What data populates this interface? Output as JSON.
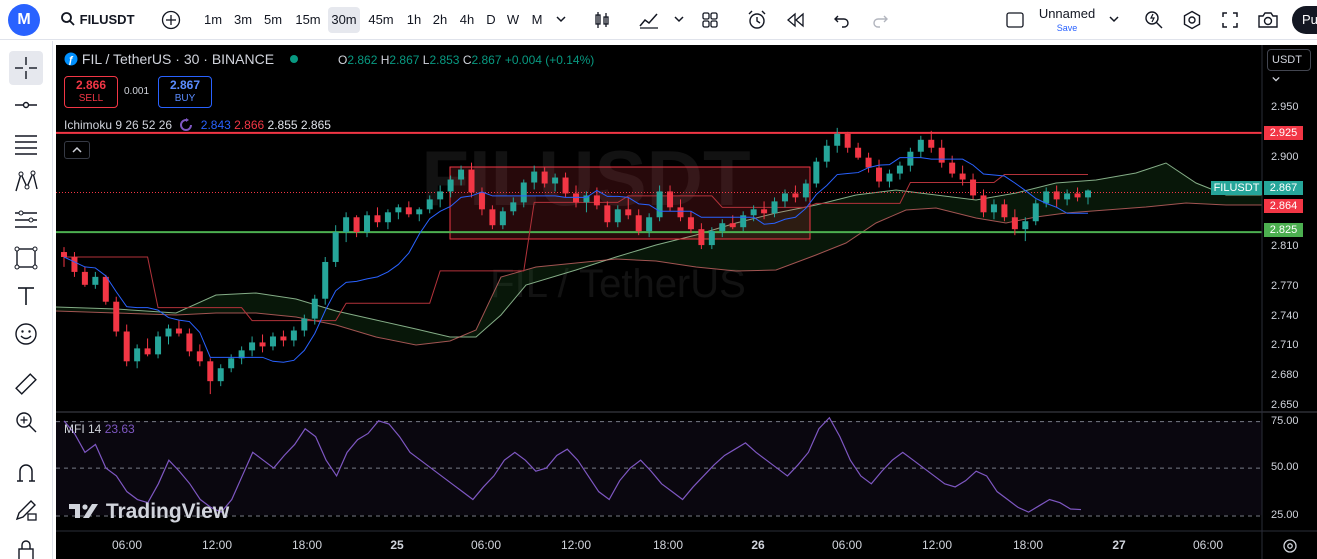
{
  "header": {
    "logo": "M",
    "symbol": "FILUSDT",
    "intervals": [
      "1m",
      "3m",
      "5m",
      "15m",
      "30m",
      "45m",
      "1h",
      "2h",
      "4h",
      "D",
      "W",
      "M"
    ],
    "selected_interval": "30m",
    "layout_name": "Unnamed",
    "save_label": "Save",
    "publish_label": "Pu"
  },
  "legend": {
    "title": "FIL / TetherUS · 30 · BINANCE",
    "o_label": "O",
    "o": "2.862",
    "h_label": "H",
    "h": "2.867",
    "l_label": "L",
    "l": "2.853",
    "c_label": "C",
    "c": "2.867",
    "change": "+0.004 (+0.14%)",
    "sell_price": "2.866",
    "sell_label": "SELL",
    "spread": "0.001",
    "buy_price": "2.867",
    "buy_label": "BUY",
    "ichimoku_label": "Ichimoku 9 26 52 26",
    "ichimoku_values": [
      "2.843",
      "2.866",
      "2.855",
      "2.865"
    ],
    "ichimoku_colors": [
      "#2962ff",
      "#f23645",
      "#e0e3eb",
      "#e0e3eb"
    ],
    "mfi_label": "MFI 14",
    "mfi_value": "23.63",
    "currency": "USDT"
  },
  "watermark": {
    "big": "FILUSDT",
    "small": "FIL / TetherUS"
  },
  "price_axis": [
    "2.950",
    "2.900",
    "2.810",
    "2.770",
    "2.740",
    "2.710",
    "2.680",
    "2.650"
  ],
  "price_tags": {
    "resistance": "2.925",
    "symbol": "FILUSDT",
    "last": "2.867",
    "red": "2.864",
    "support": "2.825"
  },
  "mfi_axis": [
    "75.00",
    "50.00",
    "25.00"
  ],
  "time_axis": [
    "06:00",
    "12:00",
    "18:00",
    "25",
    "06:00",
    "12:00",
    "18:00",
    "26",
    "06:00",
    "12:00",
    "18:00",
    "27",
    "06:00"
  ],
  "brand": "TradingView",
  "colors": {
    "up": "#26a69a",
    "down": "#f23645",
    "tenkan": "#2962ff",
    "kijun": "#b2323a",
    "resistance": "#f23645",
    "support": "#4caf50",
    "mfi": "#7e57c2"
  },
  "chart_data": {
    "type": "candlestick",
    "interval": "30m",
    "ylim": [
      2.65,
      2.955
    ],
    "ohlc": [
      [
        2.805,
        2.81,
        2.79,
        2.8
      ],
      [
        2.8,
        2.805,
        2.78,
        2.785
      ],
      [
        2.785,
        2.79,
        2.77,
        2.772
      ],
      [
        2.772,
        2.785,
        2.768,
        2.78
      ],
      [
        2.78,
        2.782,
        2.752,
        2.755
      ],
      [
        2.755,
        2.76,
        2.72,
        2.725
      ],
      [
        2.725,
        2.732,
        2.69,
        2.695
      ],
      [
        2.695,
        2.712,
        2.688,
        2.708
      ],
      [
        2.708,
        2.718,
        2.7,
        2.702
      ],
      [
        2.702,
        2.725,
        2.698,
        2.72
      ],
      [
        2.72,
        2.732,
        2.712,
        2.728
      ],
      [
        2.728,
        2.736,
        2.72,
        2.723
      ],
      [
        2.723,
        2.728,
        2.7,
        2.705
      ],
      [
        2.705,
        2.712,
        2.69,
        2.695
      ],
      [
        2.695,
        2.698,
        2.662,
        2.675
      ],
      [
        2.675,
        2.692,
        2.67,
        2.688
      ],
      [
        2.688,
        2.702,
        2.684,
        2.698
      ],
      [
        2.698,
        2.71,
        2.692,
        2.706
      ],
      [
        2.706,
        2.72,
        2.7,
        2.714
      ],
      [
        2.714,
        2.722,
        2.704,
        2.71
      ],
      [
        2.71,
        2.724,
        2.706,
        2.72
      ],
      [
        2.72,
        2.726,
        2.71,
        2.716
      ],
      [
        2.716,
        2.73,
        2.71,
        2.726
      ],
      [
        2.726,
        2.742,
        2.72,
        2.738
      ],
      [
        2.738,
        2.762,
        2.732,
        2.758
      ],
      [
        2.758,
        2.8,
        2.752,
        2.795
      ],
      [
        2.795,
        2.832,
        2.79,
        2.825
      ],
      [
        2.825,
        2.845,
        2.815,
        2.84
      ],
      [
        2.84,
        2.842,
        2.82,
        2.825
      ],
      [
        2.825,
        2.846,
        2.82,
        2.842
      ],
      [
        2.842,
        2.85,
        2.83,
        2.835
      ],
      [
        2.835,
        2.848,
        2.828,
        2.845
      ],
      [
        2.845,
        2.853,
        2.838,
        2.85
      ],
      [
        2.85,
        2.856,
        2.84,
        2.843
      ],
      [
        2.843,
        2.85,
        2.836,
        2.848
      ],
      [
        2.848,
        2.862,
        2.844,
        2.858
      ],
      [
        2.858,
        2.872,
        2.85,
        2.866
      ],
      [
        2.866,
        2.882,
        2.86,
        2.878
      ],
      [
        2.878,
        2.892,
        2.872,
        2.888
      ],
      [
        2.888,
        2.895,
        2.86,
        2.865
      ],
      [
        2.865,
        2.87,
        2.842,
        2.848
      ],
      [
        2.848,
        2.852,
        2.828,
        2.832
      ],
      [
        2.832,
        2.85,
        2.828,
        2.846
      ],
      [
        2.846,
        2.86,
        2.842,
        2.855
      ],
      [
        2.855,
        2.878,
        2.85,
        2.875
      ],
      [
        2.875,
        2.892,
        2.868,
        2.886
      ],
      [
        2.886,
        2.89,
        2.87,
        2.874
      ],
      [
        2.874,
        2.884,
        2.866,
        2.88
      ],
      [
        2.88,
        2.885,
        2.86,
        2.864
      ],
      [
        2.864,
        2.872,
        2.85,
        2.855
      ],
      [
        2.855,
        2.866,
        2.845,
        2.862
      ],
      [
        2.862,
        2.87,
        2.848,
        2.852
      ],
      [
        2.852,
        2.856,
        2.83,
        2.835
      ],
      [
        2.835,
        2.852,
        2.83,
        2.848
      ],
      [
        2.848,
        2.86,
        2.838,
        2.842
      ],
      [
        2.842,
        2.848,
        2.822,
        2.826
      ],
      [
        2.826,
        2.844,
        2.82,
        2.84
      ],
      [
        2.84,
        2.872,
        2.836,
        2.866
      ],
      [
        2.866,
        2.872,
        2.846,
        2.85
      ],
      [
        2.85,
        2.858,
        2.836,
        2.84
      ],
      [
        2.84,
        2.846,
        2.824,
        2.828
      ],
      [
        2.828,
        2.834,
        2.808,
        2.812
      ],
      [
        2.812,
        2.83,
        2.808,
        2.826
      ],
      [
        2.826,
        2.838,
        2.82,
        2.834
      ],
      [
        2.834,
        2.842,
        2.828,
        2.83
      ],
      [
        2.83,
        2.846,
        2.826,
        2.842
      ],
      [
        2.842,
        2.852,
        2.836,
        2.848
      ],
      [
        2.848,
        2.856,
        2.838,
        2.844
      ],
      [
        2.844,
        2.86,
        2.84,
        2.856
      ],
      [
        2.856,
        2.868,
        2.85,
        2.864
      ],
      [
        2.864,
        2.872,
        2.855,
        2.86
      ],
      [
        2.86,
        2.878,
        2.856,
        2.874
      ],
      [
        2.874,
        2.9,
        2.87,
        2.896
      ],
      [
        2.896,
        2.918,
        2.89,
        2.912
      ],
      [
        2.912,
        2.93,
        2.905,
        2.924
      ],
      [
        2.924,
        2.926,
        2.905,
        2.91
      ],
      [
        2.91,
        2.915,
        2.898,
        2.9
      ],
      [
        2.9,
        2.905,
        2.885,
        2.89
      ],
      [
        2.89,
        2.898,
        2.87,
        2.876
      ],
      [
        2.876,
        2.888,
        2.87,
        2.884
      ],
      [
        2.884,
        2.896,
        2.878,
        2.892
      ],
      [
        2.892,
        2.91,
        2.886,
        2.906
      ],
      [
        2.906,
        2.922,
        2.9,
        2.918
      ],
      [
        2.918,
        2.927,
        2.905,
        2.91
      ],
      [
        2.91,
        2.918,
        2.89,
        2.895
      ],
      [
        2.895,
        2.902,
        2.88,
        2.884
      ],
      [
        2.884,
        2.892,
        2.872,
        2.878
      ],
      [
        2.878,
        2.884,
        2.858,
        2.862
      ],
      [
        2.862,
        2.868,
        2.84,
        2.845
      ],
      [
        2.845,
        2.858,
        2.838,
        2.853
      ],
      [
        2.853,
        2.858,
        2.836,
        2.84
      ],
      [
        2.84,
        2.848,
        2.822,
        2.828
      ],
      [
        2.828,
        2.84,
        2.816,
        2.836
      ],
      [
        2.836,
        2.858,
        2.832,
        2.854
      ],
      [
        2.854,
        2.87,
        2.85,
        2.866
      ],
      [
        2.866,
        2.872,
        2.85,
        2.858
      ],
      [
        2.858,
        2.868,
        2.852,
        2.864
      ],
      [
        2.864,
        2.87,
        2.856,
        2.86
      ],
      [
        2.86,
        2.868,
        2.853,
        2.867
      ]
    ],
    "mfi": [
      80,
      72,
      60,
      65,
      50,
      45,
      35,
      30,
      28,
      40,
      55,
      48,
      40,
      30,
      25,
      22,
      30,
      45,
      60,
      55,
      50,
      58,
      65,
      75,
      70,
      55,
      45,
      60,
      68,
      72,
      80,
      78,
      70,
      60,
      55,
      50,
      45,
      40,
      35,
      30,
      38,
      45,
      55,
      60,
      55,
      48,
      50,
      58,
      62,
      55,
      45,
      35,
      30,
      42,
      50,
      55,
      48,
      40,
      35,
      30,
      38,
      45,
      52,
      58,
      62,
      66,
      60,
      55,
      50,
      45,
      52,
      60,
      75,
      82,
      70,
      55,
      45,
      40,
      48,
      55,
      60,
      55,
      50,
      45,
      40,
      38,
      42,
      48,
      45,
      35,
      30,
      25,
      22,
      26,
      30,
      28,
      24,
      23.63
    ],
    "resistance": 2.925,
    "support": 2.825,
    "last_price": 2.867,
    "mfi_ylim": [
      10,
      85
    ]
  }
}
